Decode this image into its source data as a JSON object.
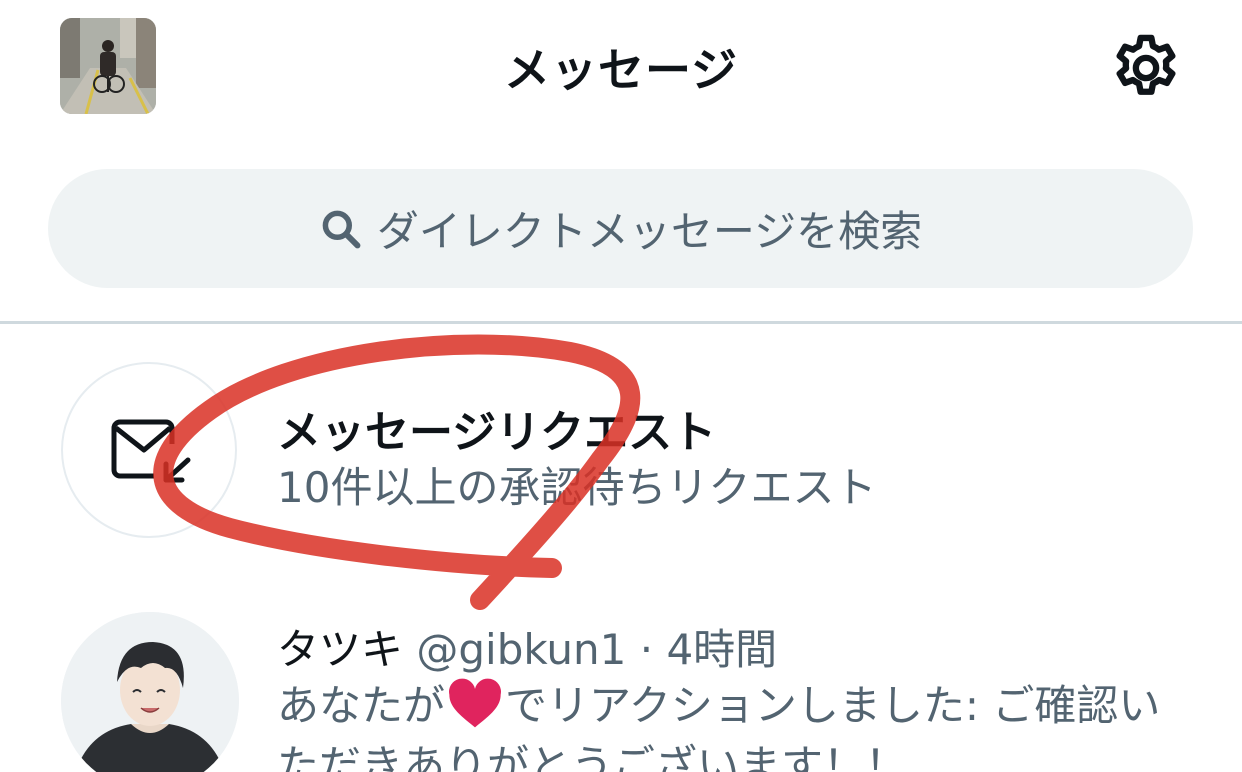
{
  "header": {
    "title": "メッセージ",
    "avatar_icon": "profile-photo",
    "settings_icon": "gear-icon"
  },
  "search": {
    "placeholder": "ダイレクトメッセージを検索",
    "icon": "search-icon"
  },
  "requests": {
    "title": "メッセージリクエスト",
    "subtitle": "10件以上の承認待ちリクエスト",
    "icon": "mail-request-icon",
    "annotation_color": "#d93025"
  },
  "conversations": [
    {
      "name": "タツキ",
      "handle": "@gibkun1",
      "separator": "·",
      "time": "4時間",
      "preview_before": "あなたが",
      "preview_emoji": "heart-icon",
      "preview_after": "でリアクションしました: ご確認いただきありがとうございます！！"
    }
  ],
  "colors": {
    "text_primary": "#0f1419",
    "text_secondary": "#536471",
    "search_bg": "#eff3f4",
    "divider": "#cfd9de",
    "heart": "#e0245e"
  }
}
